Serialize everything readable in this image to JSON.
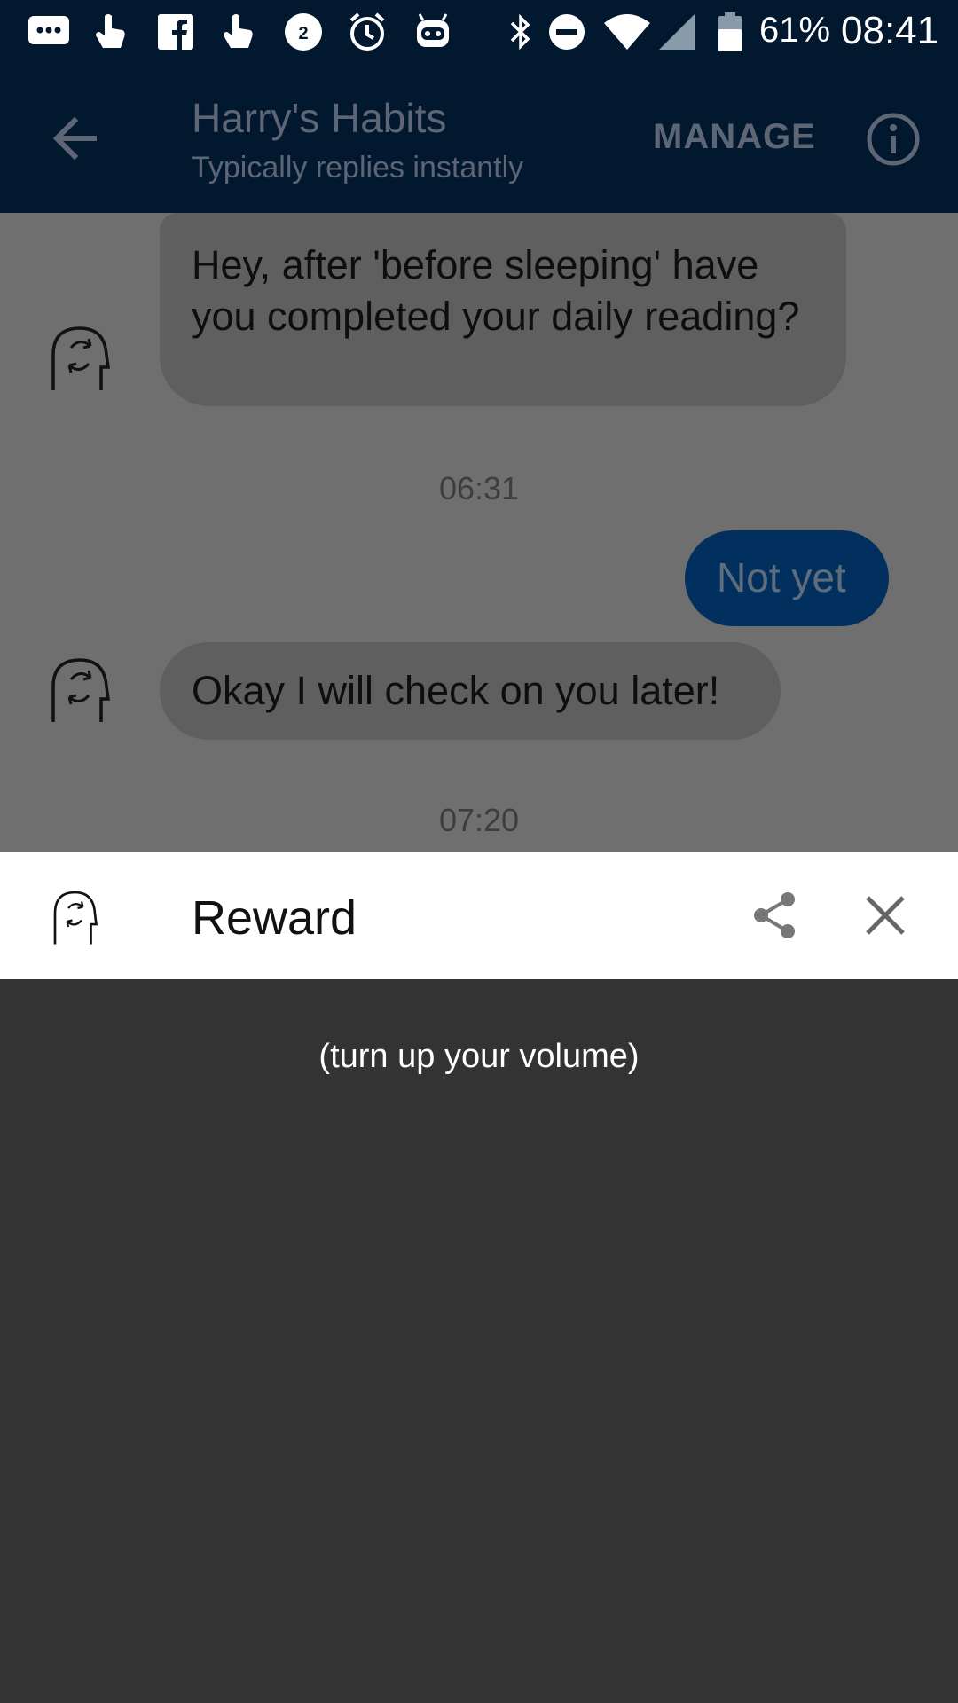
{
  "status_bar": {
    "icons": [
      "messages-icon",
      "hand-icon",
      "facebook-icon",
      "hand-icon",
      "chat-badge-icon",
      "alarm-icon",
      "robot-icon",
      "bluetooth-icon",
      "do-not-disturb-icon",
      "wifi-icon",
      "signal-icon",
      "battery-icon"
    ],
    "chat_badge_count": "2",
    "battery": "61%",
    "time": "08:41"
  },
  "app_bar": {
    "title": "Harry's Habits",
    "subtitle": "Typically replies instantly",
    "manage_label": "MANAGE"
  },
  "chat": {
    "messages": [
      {
        "from": "bot",
        "text": "Hey, after 'before sleeping' have you completed your daily reading?"
      },
      {
        "timestamp": "06:31"
      },
      {
        "from": "user",
        "text": "Not yet"
      },
      {
        "from": "bot",
        "text": "Okay I will check on you later!"
      },
      {
        "timestamp": "07:20"
      }
    ]
  },
  "reward": {
    "title": "Reward",
    "hint": "(turn up your volume)"
  },
  "colors": {
    "status_bar": "#01182f",
    "app_bar": "#01182f",
    "chat_background_dimmed": "#6f6f6f",
    "bot_bubble_dimmed": "#5f5f5f",
    "user_bubble_dimmed": "#01305f",
    "reward_header": "#ffffff",
    "reward_content": "#333333"
  }
}
